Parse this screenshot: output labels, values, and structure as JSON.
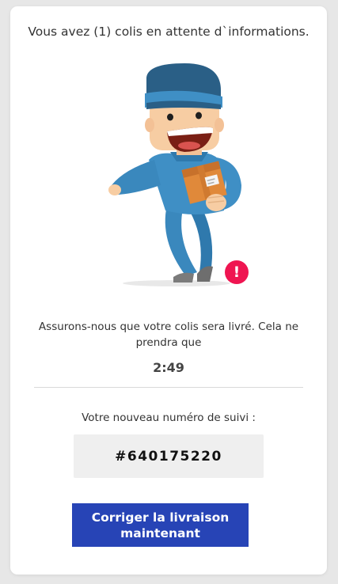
{
  "header": {
    "headline": "Vous avez (1) colis en attente d`informations."
  },
  "illustration": {
    "subject": "delivery-man-with-package",
    "alert_icon": "exclamation-icon",
    "alert_glyph": "!",
    "alert_color": "#ef1551"
  },
  "message": {
    "text": "Assurons-nous que votre colis sera livré. Cela ne prendra que"
  },
  "timer": {
    "value": "2:49"
  },
  "tracking": {
    "label": "Votre nouveau numéro de suivi :",
    "number": "#640175220"
  },
  "cta": {
    "label": "Corriger la livraison maintenant",
    "color": "#2744b6"
  }
}
